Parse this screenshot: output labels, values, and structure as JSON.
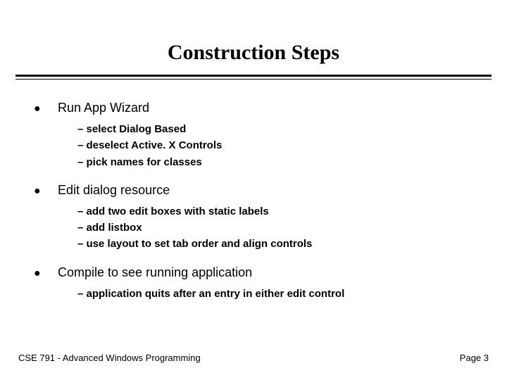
{
  "title": "Construction Steps",
  "bullets": [
    {
      "label": "Run App Wizard",
      "subs": [
        "select Dialog Based",
        "deselect Active. X Controls",
        "pick names for classes"
      ]
    },
    {
      "label": "Edit dialog resource",
      "subs": [
        "add two edit boxes with static labels",
        "add listbox",
        "use layout to set tab order and align controls"
      ]
    },
    {
      "label": "Compile to see running application",
      "subs": [
        "application quits after an entry in either edit control"
      ]
    }
  ],
  "footer": {
    "left": "CSE 791 - Advanced Windows Programming",
    "right": "Page 3"
  }
}
